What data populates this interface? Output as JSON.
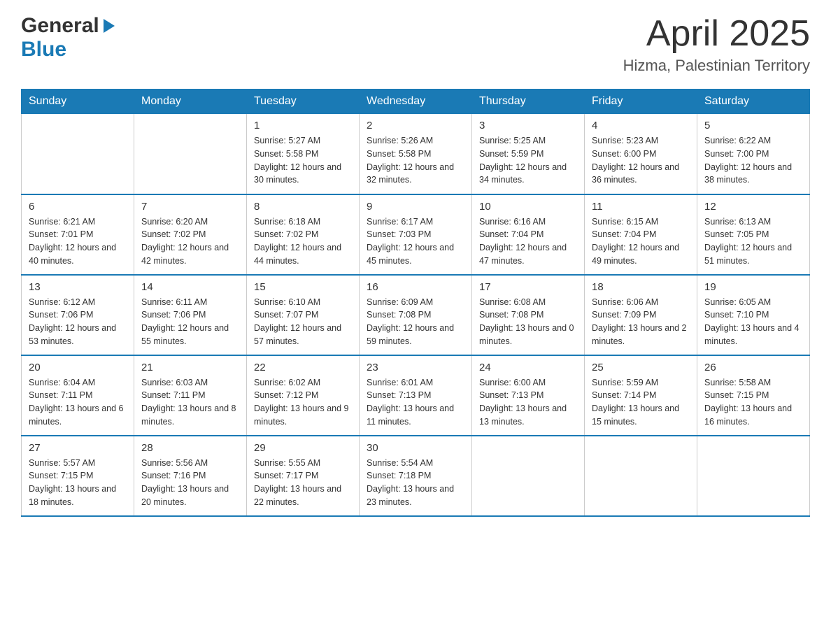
{
  "header": {
    "logo": {
      "general": "General",
      "blue": "Blue"
    },
    "title": "April 2025",
    "subtitle": "Hizma, Palestinian Territory"
  },
  "calendar": {
    "days_of_week": [
      "Sunday",
      "Monday",
      "Tuesday",
      "Wednesday",
      "Thursday",
      "Friday",
      "Saturday"
    ],
    "weeks": [
      [
        {
          "day": "",
          "sunrise": "",
          "sunset": "",
          "daylight": ""
        },
        {
          "day": "",
          "sunrise": "",
          "sunset": "",
          "daylight": ""
        },
        {
          "day": "1",
          "sunrise": "Sunrise: 5:27 AM",
          "sunset": "Sunset: 5:58 PM",
          "daylight": "Daylight: 12 hours and 30 minutes."
        },
        {
          "day": "2",
          "sunrise": "Sunrise: 5:26 AM",
          "sunset": "Sunset: 5:58 PM",
          "daylight": "Daylight: 12 hours and 32 minutes."
        },
        {
          "day": "3",
          "sunrise": "Sunrise: 5:25 AM",
          "sunset": "Sunset: 5:59 PM",
          "daylight": "Daylight: 12 hours and 34 minutes."
        },
        {
          "day": "4",
          "sunrise": "Sunrise: 5:23 AM",
          "sunset": "Sunset: 6:00 PM",
          "daylight": "Daylight: 12 hours and 36 minutes."
        },
        {
          "day": "5",
          "sunrise": "Sunrise: 6:22 AM",
          "sunset": "Sunset: 7:00 PM",
          "daylight": "Daylight: 12 hours and 38 minutes."
        }
      ],
      [
        {
          "day": "6",
          "sunrise": "Sunrise: 6:21 AM",
          "sunset": "Sunset: 7:01 PM",
          "daylight": "Daylight: 12 hours and 40 minutes."
        },
        {
          "day": "7",
          "sunrise": "Sunrise: 6:20 AM",
          "sunset": "Sunset: 7:02 PM",
          "daylight": "Daylight: 12 hours and 42 minutes."
        },
        {
          "day": "8",
          "sunrise": "Sunrise: 6:18 AM",
          "sunset": "Sunset: 7:02 PM",
          "daylight": "Daylight: 12 hours and 44 minutes."
        },
        {
          "day": "9",
          "sunrise": "Sunrise: 6:17 AM",
          "sunset": "Sunset: 7:03 PM",
          "daylight": "Daylight: 12 hours and 45 minutes."
        },
        {
          "day": "10",
          "sunrise": "Sunrise: 6:16 AM",
          "sunset": "Sunset: 7:04 PM",
          "daylight": "Daylight: 12 hours and 47 minutes."
        },
        {
          "day": "11",
          "sunrise": "Sunrise: 6:15 AM",
          "sunset": "Sunset: 7:04 PM",
          "daylight": "Daylight: 12 hours and 49 minutes."
        },
        {
          "day": "12",
          "sunrise": "Sunrise: 6:13 AM",
          "sunset": "Sunset: 7:05 PM",
          "daylight": "Daylight: 12 hours and 51 minutes."
        }
      ],
      [
        {
          "day": "13",
          "sunrise": "Sunrise: 6:12 AM",
          "sunset": "Sunset: 7:06 PM",
          "daylight": "Daylight: 12 hours and 53 minutes."
        },
        {
          "day": "14",
          "sunrise": "Sunrise: 6:11 AM",
          "sunset": "Sunset: 7:06 PM",
          "daylight": "Daylight: 12 hours and 55 minutes."
        },
        {
          "day": "15",
          "sunrise": "Sunrise: 6:10 AM",
          "sunset": "Sunset: 7:07 PM",
          "daylight": "Daylight: 12 hours and 57 minutes."
        },
        {
          "day": "16",
          "sunrise": "Sunrise: 6:09 AM",
          "sunset": "Sunset: 7:08 PM",
          "daylight": "Daylight: 12 hours and 59 minutes."
        },
        {
          "day": "17",
          "sunrise": "Sunrise: 6:08 AM",
          "sunset": "Sunset: 7:08 PM",
          "daylight": "Daylight: 13 hours and 0 minutes."
        },
        {
          "day": "18",
          "sunrise": "Sunrise: 6:06 AM",
          "sunset": "Sunset: 7:09 PM",
          "daylight": "Daylight: 13 hours and 2 minutes."
        },
        {
          "day": "19",
          "sunrise": "Sunrise: 6:05 AM",
          "sunset": "Sunset: 7:10 PM",
          "daylight": "Daylight: 13 hours and 4 minutes."
        }
      ],
      [
        {
          "day": "20",
          "sunrise": "Sunrise: 6:04 AM",
          "sunset": "Sunset: 7:11 PM",
          "daylight": "Daylight: 13 hours and 6 minutes."
        },
        {
          "day": "21",
          "sunrise": "Sunrise: 6:03 AM",
          "sunset": "Sunset: 7:11 PM",
          "daylight": "Daylight: 13 hours and 8 minutes."
        },
        {
          "day": "22",
          "sunrise": "Sunrise: 6:02 AM",
          "sunset": "Sunset: 7:12 PM",
          "daylight": "Daylight: 13 hours and 9 minutes."
        },
        {
          "day": "23",
          "sunrise": "Sunrise: 6:01 AM",
          "sunset": "Sunset: 7:13 PM",
          "daylight": "Daylight: 13 hours and 11 minutes."
        },
        {
          "day": "24",
          "sunrise": "Sunrise: 6:00 AM",
          "sunset": "Sunset: 7:13 PM",
          "daylight": "Daylight: 13 hours and 13 minutes."
        },
        {
          "day": "25",
          "sunrise": "Sunrise: 5:59 AM",
          "sunset": "Sunset: 7:14 PM",
          "daylight": "Daylight: 13 hours and 15 minutes."
        },
        {
          "day": "26",
          "sunrise": "Sunrise: 5:58 AM",
          "sunset": "Sunset: 7:15 PM",
          "daylight": "Daylight: 13 hours and 16 minutes."
        }
      ],
      [
        {
          "day": "27",
          "sunrise": "Sunrise: 5:57 AM",
          "sunset": "Sunset: 7:15 PM",
          "daylight": "Daylight: 13 hours and 18 minutes."
        },
        {
          "day": "28",
          "sunrise": "Sunrise: 5:56 AM",
          "sunset": "Sunset: 7:16 PM",
          "daylight": "Daylight: 13 hours and 20 minutes."
        },
        {
          "day": "29",
          "sunrise": "Sunrise: 5:55 AM",
          "sunset": "Sunset: 7:17 PM",
          "daylight": "Daylight: 13 hours and 22 minutes."
        },
        {
          "day": "30",
          "sunrise": "Sunrise: 5:54 AM",
          "sunset": "Sunset: 7:18 PM",
          "daylight": "Daylight: 13 hours and 23 minutes."
        },
        {
          "day": "",
          "sunrise": "",
          "sunset": "",
          "daylight": ""
        },
        {
          "day": "",
          "sunrise": "",
          "sunset": "",
          "daylight": ""
        },
        {
          "day": "",
          "sunrise": "",
          "sunset": "",
          "daylight": ""
        }
      ]
    ]
  }
}
